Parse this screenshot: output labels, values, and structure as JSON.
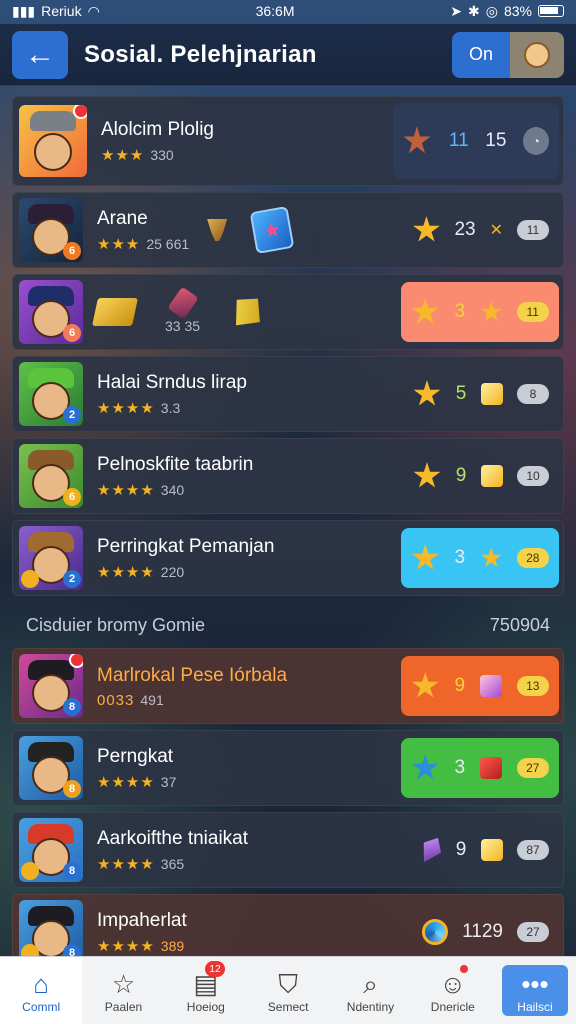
{
  "status": {
    "carrier": "Reriuk",
    "time": "36:6M",
    "battery": "83%"
  },
  "header": {
    "title": "Sosial.  Pelehjnarian",
    "toggle_label": "On"
  },
  "rows": [
    {
      "name": "Alolcim Plolig",
      "stars": "★★★",
      "score": "330",
      "num1": "11",
      "num2": "15"
    },
    {
      "name": "Arane",
      "stars": "★★★",
      "score": "25 661",
      "num": "23",
      "pill": "11"
    },
    {
      "score": "33 35",
      "num": "3",
      "pill": "11"
    },
    {
      "name": "Halai Srndus lirap",
      "stars": "★★★★",
      "score": "3.3",
      "num": "5",
      "pill": "8"
    },
    {
      "name": "Pelnoskfite taabrin",
      "stars": "★★★★",
      "score": "340",
      "num": "9",
      "pill": "10"
    },
    {
      "name": "Perringkat Pemanjan",
      "stars": "★★★★",
      "score": "220",
      "num": "3",
      "pill": "28"
    }
  ],
  "section": {
    "label": "Cisduier bromy Gomie",
    "value": "750904"
  },
  "rows2": [
    {
      "name": "Marlrokal Pese Iórbala",
      "stars": "0033",
      "score": "491",
      "num": "9",
      "pill": "13"
    },
    {
      "name": "Perngkat",
      "stars": "★★★★",
      "score": "37",
      "num": "3",
      "pill": "27"
    },
    {
      "name": "Aarkoifthe tniaikat",
      "stars": "★★★★",
      "score": "365",
      "num": "9",
      "pill": "87"
    },
    {
      "name": "Impaherlat",
      "stars": "★★★★",
      "score": "389",
      "num": "1129",
      "pill": "27"
    }
  ],
  "nav": [
    {
      "label": "Comml",
      "icon": "home-icon"
    },
    {
      "label": "Paalen",
      "icon": "star-icon"
    },
    {
      "label": "Hoeiog",
      "icon": "list-icon",
      "badge": "12"
    },
    {
      "label": "Semect",
      "icon": "shield-icon"
    },
    {
      "label": "Ndentiny",
      "icon": "search-icon"
    },
    {
      "label": "Dnericle",
      "icon": "profile-icon"
    },
    {
      "label": "Hailsci",
      "icon": "more-icon"
    }
  ]
}
